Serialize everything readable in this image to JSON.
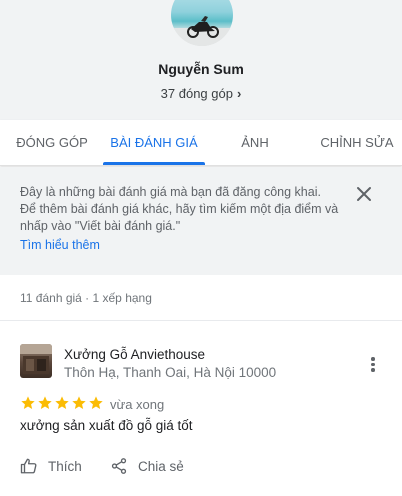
{
  "profile": {
    "name": "Nguyễn Sum",
    "contributions": "37 đóng góp",
    "chevron": "›"
  },
  "tabs": [
    {
      "label": "ĐÓNG GÓP",
      "active": false
    },
    {
      "label": "BÀI ĐÁNH GIÁ",
      "active": true
    },
    {
      "label": "ẢNH",
      "active": false
    },
    {
      "label": "CHỈNH SỬA",
      "active": false
    }
  ],
  "info_banner": {
    "text": "Đây là những bài đánh giá mà bạn đã đăng công khai. Để thêm bài đánh giá khác, hãy tìm kiếm một địa điểm và nhấp vào \"Viết bài đánh giá.\"",
    "link": "Tìm hiểu thêm",
    "close_icon": "close-icon"
  },
  "summary": "11 đánh giá · 1 xếp hạng",
  "review": {
    "place_name": "Xưởng Gỗ Anviethouse",
    "address": "Thôn Hạ, Thanh Oai, Hà Nội 10000",
    "rating": 5,
    "max_rating": 5,
    "time": "vừa xong",
    "text": "xưởng sản xuất đồ gỗ giá tốt",
    "actions": {
      "like": "Thích",
      "share": "Chia sẻ"
    }
  },
  "colors": {
    "accent": "#1a73e8",
    "star": "#fbbc04",
    "header_bg": "#f1f3f4"
  }
}
